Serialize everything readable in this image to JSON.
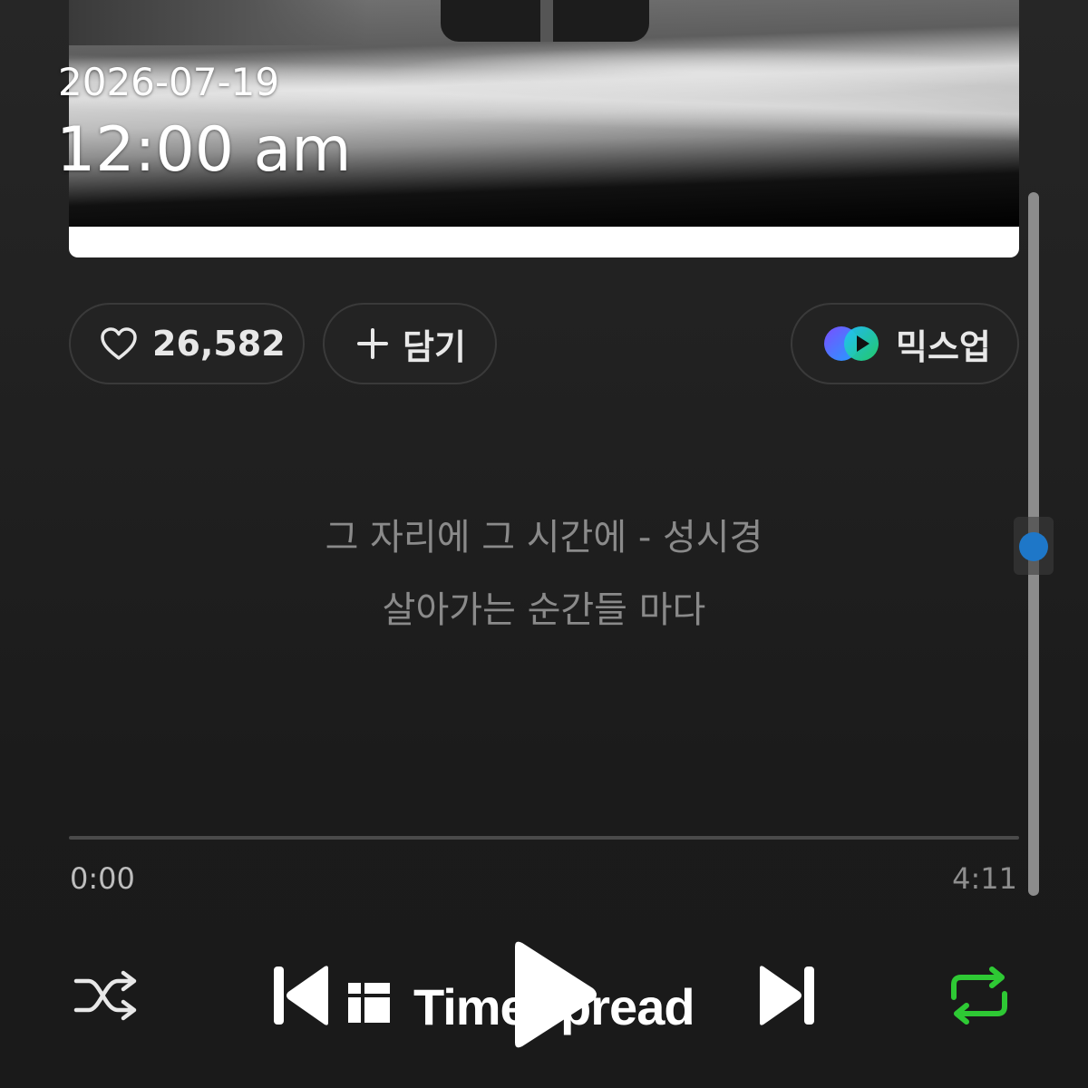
{
  "clock": {
    "date": "2026-07-19",
    "time": "12:00 am"
  },
  "actions": {
    "like_count": "26,582",
    "add_label": "담기",
    "mixup_label": "믹스업"
  },
  "lyrics": [
    "그 자리에 그 시간에 - 성시경",
    "살아가는 순간들 마다"
  ],
  "player": {
    "current_time": "0:00",
    "total_time": "4:11",
    "progress": 0.0,
    "repeat_active": true
  },
  "watermark": {
    "text": "TimeSpread"
  },
  "colors": {
    "accent_green": "#2ec934",
    "scroll_dot": "#1e77c8",
    "mixup_gradient": [
      "#7b4dff",
      "#20c0ff",
      "#22d36e"
    ]
  },
  "icons": [
    "heart-icon",
    "plus-icon",
    "mixup-icon",
    "shuffle-icon",
    "previous-icon",
    "play-icon",
    "next-icon",
    "repeat-icon"
  ]
}
